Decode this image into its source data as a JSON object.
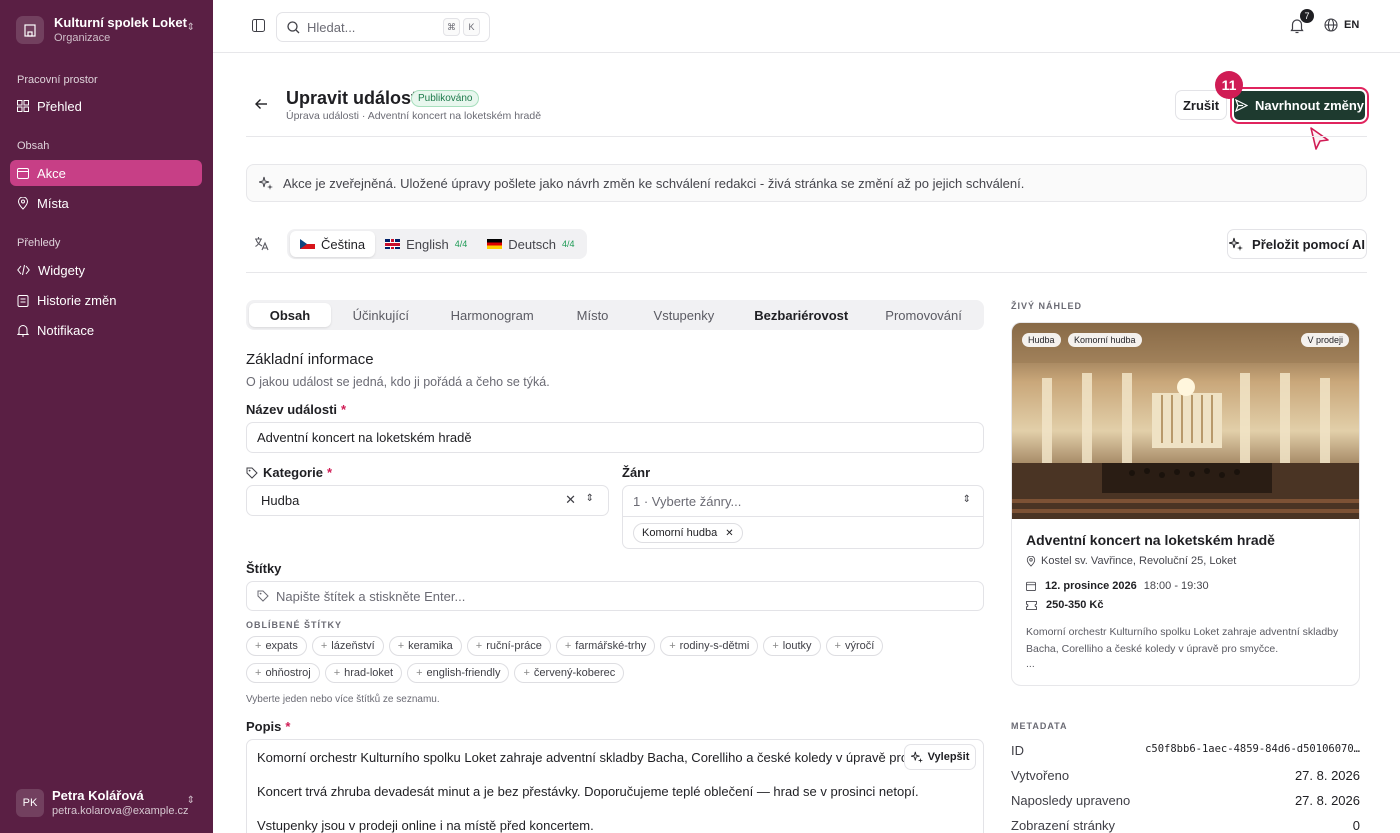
{
  "sidebar": {
    "org_name": "Kulturní spolek Loket",
    "org_type": "Organizace",
    "sections": {
      "workspace": "Pracovní prostor",
      "content": "Obsah",
      "reports": "Přehledy"
    },
    "items": {
      "overview": "Přehled",
      "events": "Akce",
      "places": "Místa",
      "widgets": "Widgety",
      "history": "Historie změn",
      "notifications": "Notifikace"
    },
    "user": {
      "initials": "PK",
      "name": "Petra Kolářová",
      "email": "petra.kolarova@example.cz"
    }
  },
  "topbar": {
    "search_placeholder": "Hledat...",
    "kbd1": "⌘",
    "kbd2": "K",
    "notif_count": "7",
    "lang": "EN"
  },
  "header": {
    "title": "Upravit událost",
    "status": "Publikováno",
    "breadcrumb": "Úprava události · Adventní koncert na loketském hradě",
    "cancel": "Zrušit",
    "propose": "Navrhnout změny",
    "step": "11"
  },
  "info_text": "Akce je zveřejněná. Uložené úpravy pošlete jako návrh změn ke schválení redakci - živá stránka se změní až po jejich schválení.",
  "languages": [
    {
      "label": "Čeština",
      "count": ""
    },
    {
      "label": "English",
      "count": "4/4"
    },
    {
      "label": "Deutsch",
      "count": "4/4"
    }
  ],
  "translate_ai": "Přeložit pomocí AI",
  "tabs": [
    "Obsah",
    "Účinkující",
    "Harmonogram",
    "Místo",
    "Vstupenky",
    "Bezbariérovost",
    "Promovování"
  ],
  "form": {
    "section_title": "Základní informace",
    "section_desc": "O jakou událost se jedná, kdo ji pořádá a čeho se týká.",
    "name_label": "Název události",
    "name_value": "Adventní koncert na loketském hradě",
    "category_label": "Kategorie",
    "category_value": "Hudba",
    "genre_label": "Žánr",
    "genre_placeholder": "1 · Vyberte žánry...",
    "genre_selected": "Komorní hudba",
    "tags_label": "Štítky",
    "tags_placeholder": "Napište štítek a stiskněte Enter...",
    "popular_label": "OBLÍBENÉ ŠTÍTKY",
    "popular_row1": [
      "expats",
      "lázeňství",
      "keramika",
      "ruční-práce",
      "farmářské-trhy",
      "rodiny-s-dětmi",
      "loutky",
      "výročí"
    ],
    "popular_row2": [
      "ohňostroj",
      "hrad-loket",
      "english-friendly",
      "červený-koberec"
    ],
    "tags_hint": "Vyberte jeden nebo více štítků ze seznamu.",
    "desc_label": "Popis",
    "improve": "Vylepšit",
    "desc_p1": "Komorní orchestr Kulturního spolku Loket zahraje adventní skladby Bacha, Corelliho a české koledy v úpravě pro smyčce.",
    "desc_p2": "Koncert trvá zhruba devadesát minut a je bez přestávky. Doporučujeme teplé oblečení — hrad se v prosinci netopí.",
    "desc_p3": "Vstupenky jsou v prodeji online i na místě před koncertem."
  },
  "preview": {
    "label": "ŽIVÝ NÁHLED",
    "tag1": "Hudba",
    "tag2": "Komorní hudba",
    "sale": "V prodeji",
    "title": "Adventní koncert na loketském hradě",
    "place": "Kostel sv. Vavřince, Revoluční 25, Loket",
    "date": "12. prosince 2026",
    "time": "18:00 - 19:30",
    "price": "250-350 Kč",
    "desc": "Komorní orchestr Kulturního spolku Loket zahraje adventní skladby Bacha, Corelliho a české koledy v úpravě pro smyčce.",
    "ellipsis": "..."
  },
  "metadata": {
    "label": "METADATA",
    "rows": [
      {
        "k": "ID",
        "v": "c50f8bb6-1aec-4859-84d6-d50106070…"
      },
      {
        "k": "Vytvořeno",
        "v": "27. 8. 2026"
      },
      {
        "k": "Naposledy upraveno",
        "v": "27. 8. 2026"
      },
      {
        "k": "Zobrazení stránky",
        "v": "0"
      }
    ]
  }
}
